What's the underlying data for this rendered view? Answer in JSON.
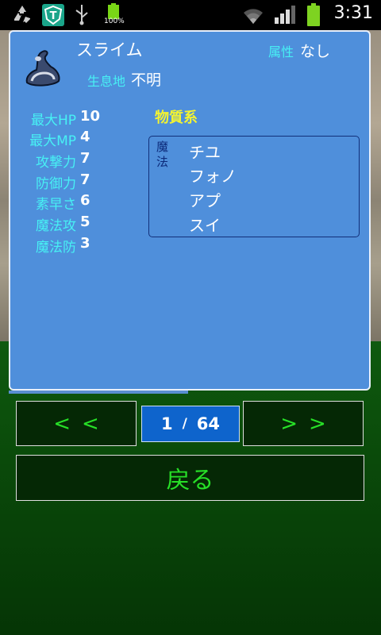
{
  "status_bar": {
    "time": "3:31",
    "battery_small_label": "100%",
    "icons": [
      "recycle-icon",
      "shield-t-icon",
      "usb-icon",
      "battery-small-icon",
      "wifi-icon",
      "signal-icon",
      "battery-icon"
    ]
  },
  "monster": {
    "name": "スライム",
    "attribute_label": "属性",
    "attribute_value": "なし",
    "habitat_label": "生息地",
    "habitat_value": "不明",
    "category": "物質系"
  },
  "stats": [
    {
      "label": "最大HP",
      "value": "10"
    },
    {
      "label": "最大MP",
      "value": "4"
    },
    {
      "label": "攻撃力",
      "value": "7"
    },
    {
      "label": "防御力",
      "value": "7"
    },
    {
      "label": "素早さ",
      "value": "6"
    },
    {
      "label": "魔法攻",
      "value": "5"
    },
    {
      "label": "魔法防",
      "value": "3"
    }
  ],
  "magic": {
    "label": "魔法",
    "spells": [
      "チユ",
      "フォノ",
      "アプ",
      "スイ"
    ]
  },
  "nav": {
    "prev_label": "<<",
    "next_label": ">>",
    "current_page": "1",
    "separator": "/",
    "total_pages": "64",
    "back_label": "戻る"
  },
  "colors": {
    "panel_bg": "#4f8fdb",
    "label_cyan": "#47f1f4",
    "category_yellow": "#f4f430",
    "button_green": "#27e027",
    "page_box_blue": "#0e64cc"
  }
}
